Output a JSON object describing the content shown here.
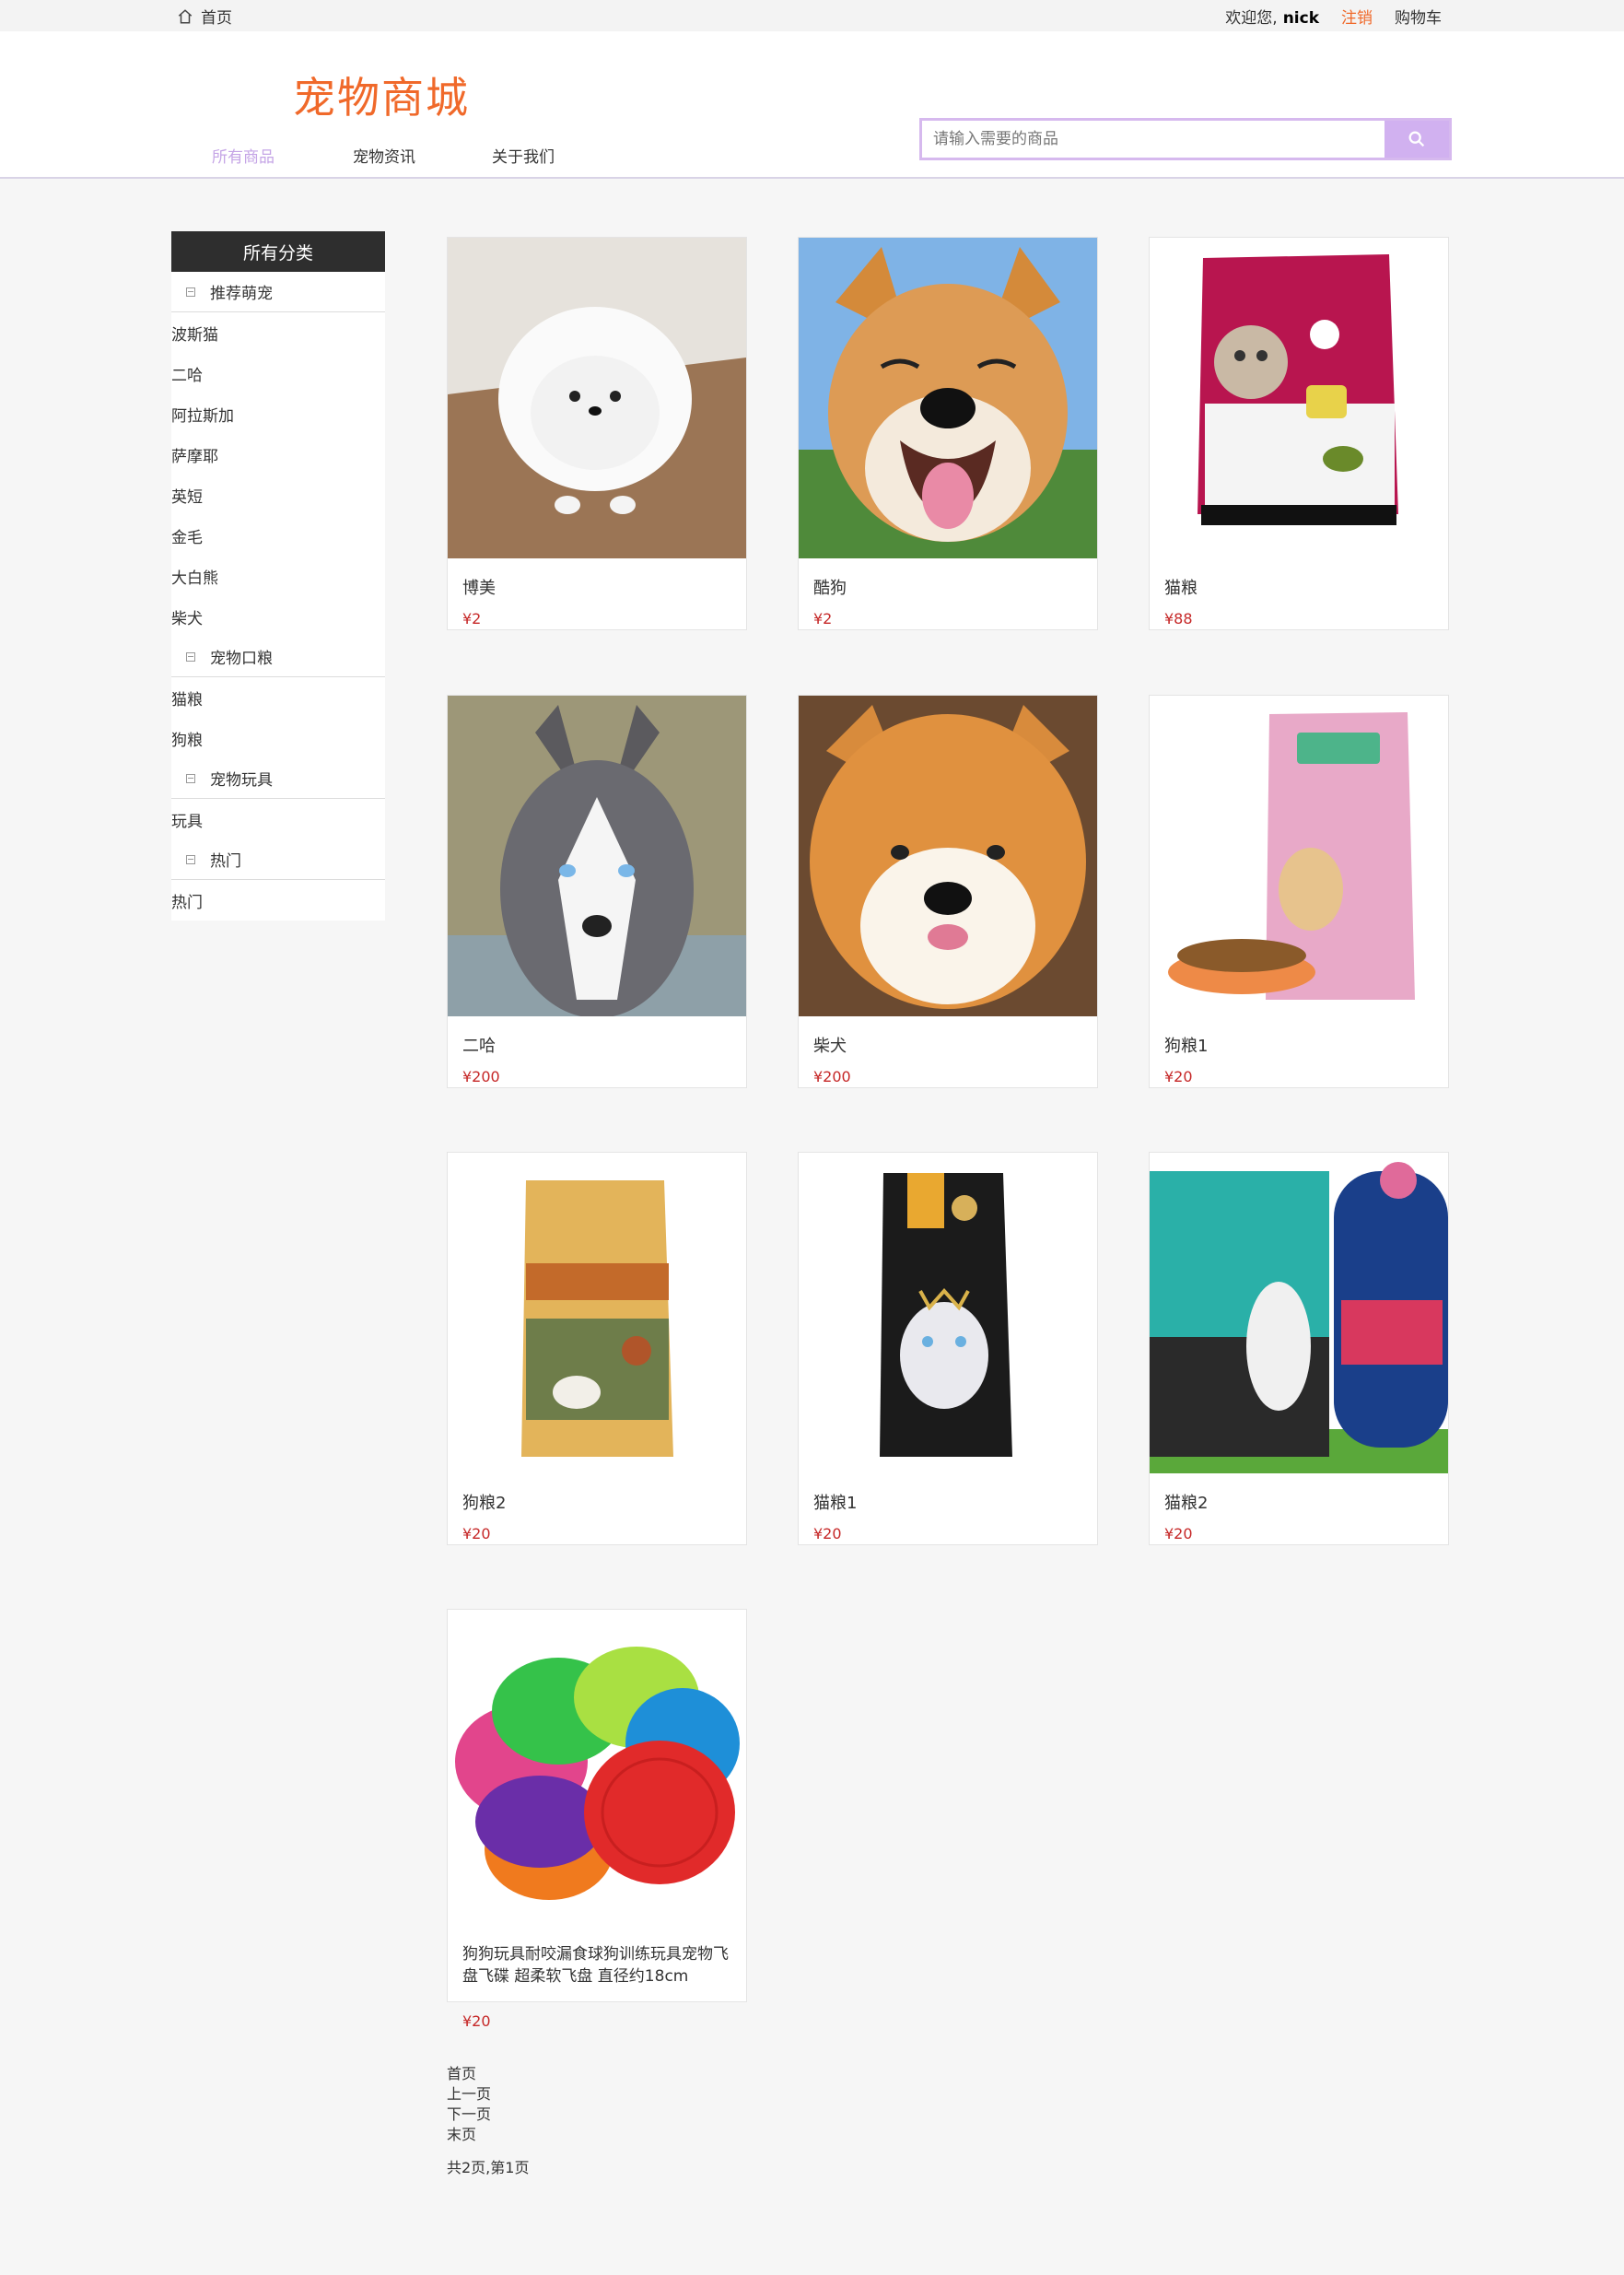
{
  "topbar": {
    "home": "首页",
    "welcome": "欢迎您,",
    "username": "nick",
    "logout": "注销",
    "cart": "购物车"
  },
  "header": {
    "logo": "宠物商城",
    "nav": [
      "所有商品",
      "宠物资讯",
      "关于我们"
    ],
    "search_placeholder": "请输入需要的商品"
  },
  "sidebar": {
    "title": "所有分类",
    "groups": [
      {
        "label": "推荐萌宠",
        "items": [
          "波斯猫",
          "二哈",
          "阿拉斯加",
          "萨摩耶",
          "英短",
          "金毛",
          "大白熊",
          "柴犬"
        ]
      },
      {
        "label": "宠物口粮",
        "items": [
          "猫粮",
          "狗粮"
        ]
      },
      {
        "label": "宠物玩具",
        "items": [
          "玩具"
        ]
      },
      {
        "label": "热门",
        "items": [
          "热门"
        ]
      }
    ]
  },
  "products": [
    {
      "name": "博美",
      "price": "¥2"
    },
    {
      "name": "酷狗",
      "price": "¥2"
    },
    {
      "name": "猫粮",
      "price": "¥88"
    },
    {
      "name": "二哈",
      "price": "¥200"
    },
    {
      "name": "柴犬",
      "price": "¥200"
    },
    {
      "name": "狗粮1",
      "price": "¥20"
    },
    {
      "name": "狗粮2",
      "price": "¥20"
    },
    {
      "name": "猫粮1",
      "price": "¥20"
    },
    {
      "name": "猫粮2",
      "price": "¥20"
    },
    {
      "name": "狗狗玩具耐咬漏食球狗训练玩具宠物飞盘飞碟 超柔软飞盘 直径约18cm",
      "price": "¥20"
    }
  ],
  "pagination": {
    "first": "首页",
    "prev": "上一页",
    "next": "下一页",
    "last": "末页",
    "info": "共2页,第1页"
  },
  "colors": {
    "accent": "#f0692a",
    "nav_active": "#c5a5e6",
    "search_button": "#d1b1f0",
    "price": "#c62828"
  }
}
